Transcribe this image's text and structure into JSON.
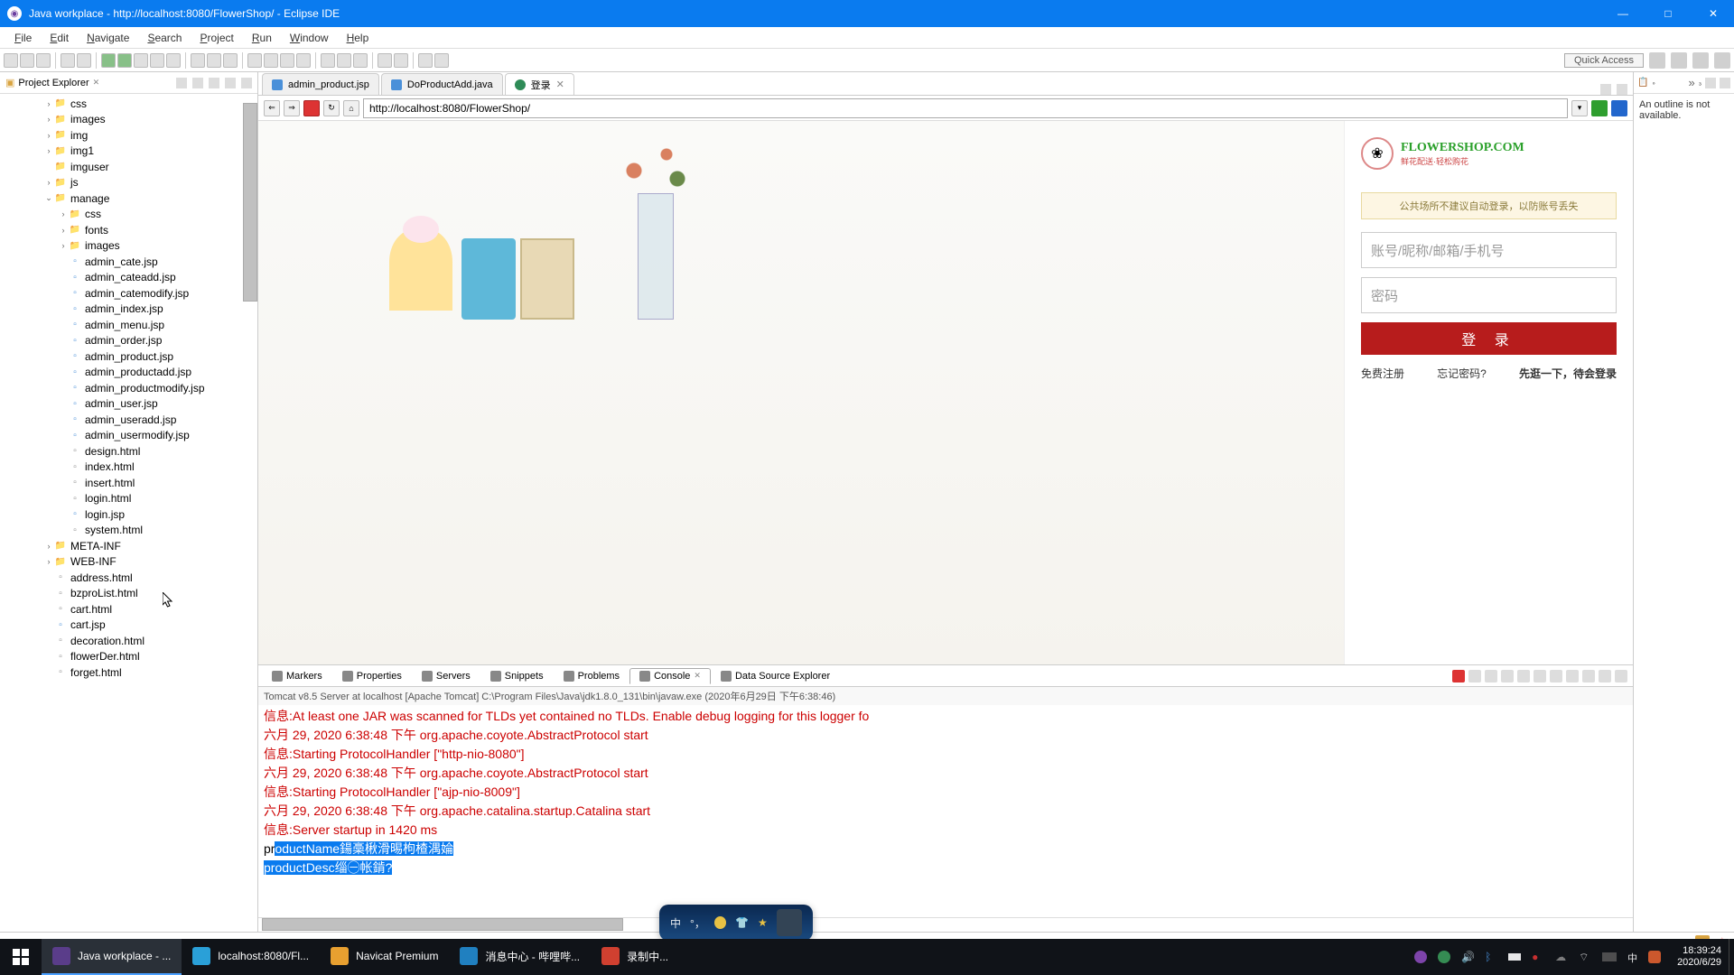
{
  "title": "Java workplace - http://localhost:8080/FlowerShop/ - Eclipse IDE",
  "menu": [
    "File",
    "Edit",
    "Navigate",
    "Search",
    "Project",
    "Run",
    "Window",
    "Help"
  ],
  "quick_access": "Quick Access",
  "project_explorer": {
    "title": "Project Explorer",
    "tree": [
      {
        "d": 3,
        "t": "f",
        "n": "css",
        "tw": ">"
      },
      {
        "d": 3,
        "t": "f",
        "n": "images",
        "tw": ">"
      },
      {
        "d": 3,
        "t": "f",
        "n": "img",
        "tw": ">"
      },
      {
        "d": 3,
        "t": "f",
        "n": "img1",
        "tw": ">"
      },
      {
        "d": 3,
        "t": "f",
        "n": "imguser",
        "tw": ""
      },
      {
        "d": 3,
        "t": "f",
        "n": "js",
        "tw": ">"
      },
      {
        "d": 3,
        "t": "f",
        "n": "manage",
        "tw": "v"
      },
      {
        "d": 4,
        "t": "f",
        "n": "css",
        "tw": ">"
      },
      {
        "d": 4,
        "t": "f",
        "n": "fonts",
        "tw": ">"
      },
      {
        "d": 4,
        "t": "f",
        "n": "images",
        "tw": ">"
      },
      {
        "d": 4,
        "t": "j",
        "n": "admin_cate.jsp"
      },
      {
        "d": 4,
        "t": "j",
        "n": "admin_cateadd.jsp"
      },
      {
        "d": 4,
        "t": "j",
        "n": "admin_catemodify.jsp"
      },
      {
        "d": 4,
        "t": "j",
        "n": "admin_index.jsp"
      },
      {
        "d": 4,
        "t": "j",
        "n": "admin_menu.jsp"
      },
      {
        "d": 4,
        "t": "j",
        "n": "admin_order.jsp"
      },
      {
        "d": 4,
        "t": "j",
        "n": "admin_product.jsp"
      },
      {
        "d": 4,
        "t": "j",
        "n": "admin_productadd.jsp"
      },
      {
        "d": 4,
        "t": "j",
        "n": "admin_productmodify.jsp"
      },
      {
        "d": 4,
        "t": "j",
        "n": "admin_user.jsp"
      },
      {
        "d": 4,
        "t": "j",
        "n": "admin_useradd.jsp"
      },
      {
        "d": 4,
        "t": "j",
        "n": "admin_usermodify.jsp"
      },
      {
        "d": 4,
        "t": "h",
        "n": "design.html"
      },
      {
        "d": 4,
        "t": "h",
        "n": "index.html"
      },
      {
        "d": 4,
        "t": "h",
        "n": "insert.html"
      },
      {
        "d": 4,
        "t": "h",
        "n": "login.html"
      },
      {
        "d": 4,
        "t": "j",
        "n": "login.jsp"
      },
      {
        "d": 4,
        "t": "h",
        "n": "system.html"
      },
      {
        "d": 3,
        "t": "f",
        "n": "META-INF",
        "tw": ">"
      },
      {
        "d": 3,
        "t": "f",
        "n": "WEB-INF",
        "tw": ">"
      },
      {
        "d": 3,
        "t": "h",
        "n": "address.html"
      },
      {
        "d": 3,
        "t": "h",
        "n": "bzproList.html"
      },
      {
        "d": 3,
        "t": "h",
        "n": "cart.html"
      },
      {
        "d": 3,
        "t": "j",
        "n": "cart.jsp"
      },
      {
        "d": 3,
        "t": "h",
        "n": "decoration.html"
      },
      {
        "d": 3,
        "t": "h",
        "n": "flowerDer.html"
      },
      {
        "d": 3,
        "t": "h",
        "n": "forget.html"
      }
    ]
  },
  "tabs": [
    {
      "label": "admin_product.jsp",
      "active": false,
      "icon": "jsp"
    },
    {
      "label": "DoProductAdd.java",
      "active": false,
      "icon": "java"
    },
    {
      "label": "登录",
      "active": true,
      "icon": "globe"
    }
  ],
  "url": "http://localhost:8080/FlowerShop/",
  "outline_msg": "An outline is not available.",
  "login": {
    "logo": "FLOWERSHOP.COM",
    "logo_sub": "鲜花配送·轻松购花",
    "warn": "公共场所不建议自动登录，以防账号丢失",
    "user_ph": "账号/昵称/邮箱/手机号",
    "pass_ph": "密码",
    "btn": "登 录",
    "link1": "免费注册",
    "link2": "忘记密码?",
    "link3": "先逛一下，待会登录"
  },
  "bottom_tabs": [
    "Markers",
    "Properties",
    "Servers",
    "Snippets",
    "Problems",
    "Console",
    "Data Source Explorer"
  ],
  "bottom_active": 5,
  "console_desc": "Tomcat v8.5 Server at localhost [Apache Tomcat] C:\\Program Files\\Java\\jdk1.8.0_131\\bin\\javaw.exe (2020年6月29日 下午6:38:46)",
  "console_lines": [
    {
      "pre": "信息:",
      "msg": "At least one JAR was scanned for TLDs yet contained no TLDs. Enable debug logging for this logger fo"
    },
    {
      "pre": "六月 29, 2020 6:38:48 下午 ",
      "msg": "org.apache.coyote.AbstractProtocol start"
    },
    {
      "pre": "信息:",
      "msg": "Starting ProtocolHandler [\"http-nio-8080\"]"
    },
    {
      "pre": "六月 29, 2020 6:38:48 下午 ",
      "msg": "org.apache.coyote.AbstractProtocol start"
    },
    {
      "pre": "信息:",
      "msg": "Starting ProtocolHandler [\"ajp-nio-8009\"]"
    },
    {
      "pre": "六月 29, 2020 6:38:48 下午 ",
      "msg": "org.apache.catalina.startup.Catalina start"
    },
    {
      "pre": "信息:",
      "msg": "Server startup in 1420 ms"
    }
  ],
  "console_sel": {
    "plain": "pr",
    "sel1": "oductName鍚槀楸滑晹枸楂湡婨",
    "sel2": "productDesc缁㊀帐錹?"
  },
  "ime": {
    "label": "中"
  },
  "taskbar": [
    {
      "icon": "eclipse",
      "label": "Java workplace - ...",
      "active": true,
      "color": "#5a3d8a"
    },
    {
      "icon": "chrome",
      "label": "localhost:8080/Fl...",
      "active": false,
      "color": "#2aa0d8"
    },
    {
      "icon": "navicat",
      "label": "Navicat Premium",
      "active": false,
      "color": "#e8a030"
    },
    {
      "icon": "bili",
      "label": "消息中心 - 哔哩哔...",
      "active": false,
      "color": "#2080c0"
    },
    {
      "icon": "rec",
      "label": "录制中...",
      "active": false,
      "color": "#d04030"
    }
  ],
  "clock": {
    "time": "18:39:24",
    "date": "2020/6/29"
  }
}
